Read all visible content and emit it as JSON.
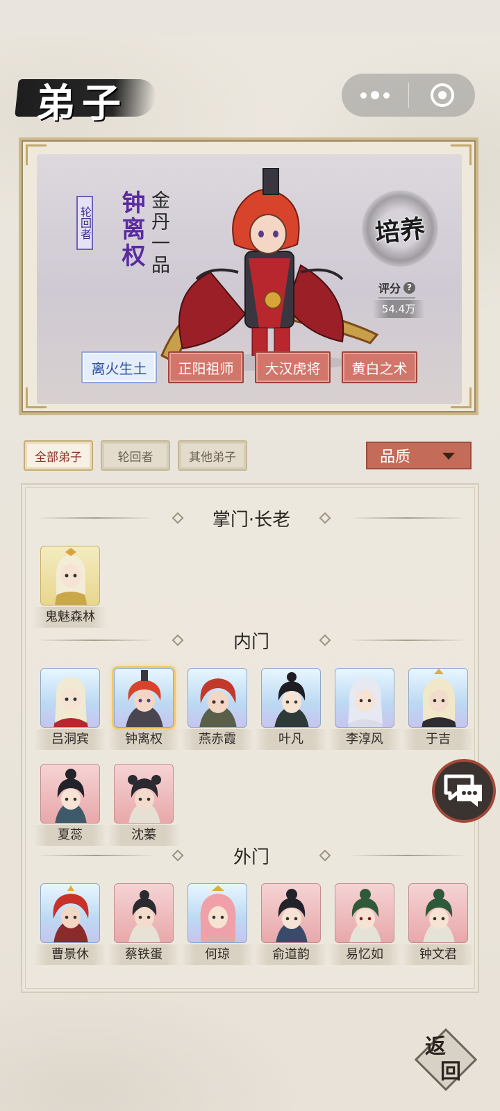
{
  "page": {
    "title": "弟子"
  },
  "hero": {
    "tag": "轮回者",
    "name": "钟离权",
    "rank": "金丹一品",
    "cultivate_label": "培养",
    "score_label": "评分",
    "score_value": "54.4万",
    "traits": [
      "离火生土",
      "正阳祖师",
      "大汉虎将",
      "黄白之术"
    ]
  },
  "filters": {
    "tabs": [
      "全部弟子",
      "轮回者",
      "其他弟子"
    ],
    "sort": "品质"
  },
  "sections": [
    {
      "title": "掌门·长老",
      "members": [
        "鬼魅森林"
      ]
    },
    {
      "title": "内门",
      "members": [
        "吕洞宾",
        "钟离权",
        "燕赤霞",
        "叶凡",
        "李淳风",
        "于吉",
        "夏蕊",
        "沈蓁"
      ]
    },
    {
      "title": "外门",
      "members": [
        "曹景休",
        "蔡铁蛋",
        "何琼",
        "俞道韵",
        "易忆如",
        "钟文君"
      ]
    }
  ],
  "back_label": [
    "返",
    "回"
  ],
  "colors": {
    "accent_red": "#c46b59",
    "selected_glow": "#f4c86b",
    "trait_blue": "#2f4fa1"
  }
}
